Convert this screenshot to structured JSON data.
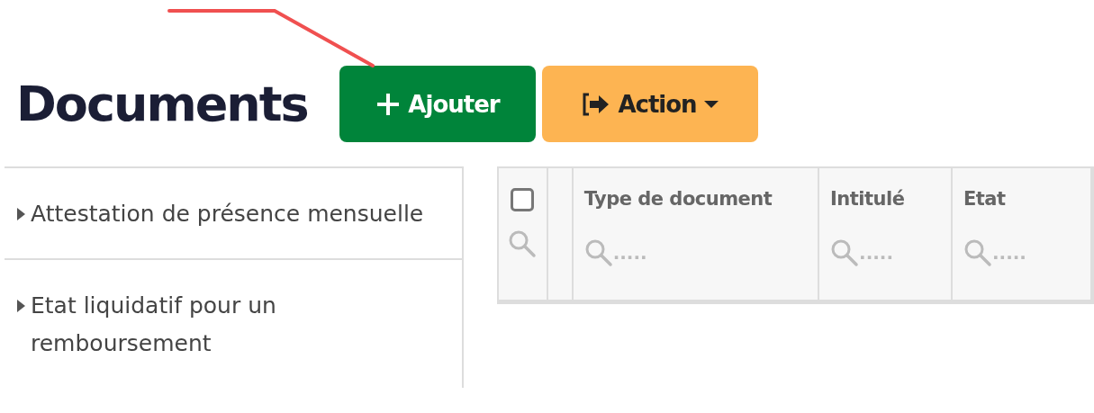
{
  "title": "Documents",
  "buttons": [
    {
      "kind": "add",
      "label": "Ajouter"
    },
    {
      "kind": "action",
      "label": "Action"
    }
  ],
  "sidebar": {
    "items": [
      {
        "label": "Attestation de présence mensuelle",
        "expanded": false
      },
      {
        "label": "Etat liquidatif pour un remboursement",
        "expanded": false
      }
    ]
  },
  "table": {
    "select_all": {
      "checked": false
    },
    "columns": [
      {
        "label": "Type de document",
        "filter_placeholder": "....."
      },
      {
        "label": "Intitulé",
        "filter_placeholder": "....."
      },
      {
        "label": "Etat",
        "filter_placeholder": "....."
      }
    ]
  }
}
